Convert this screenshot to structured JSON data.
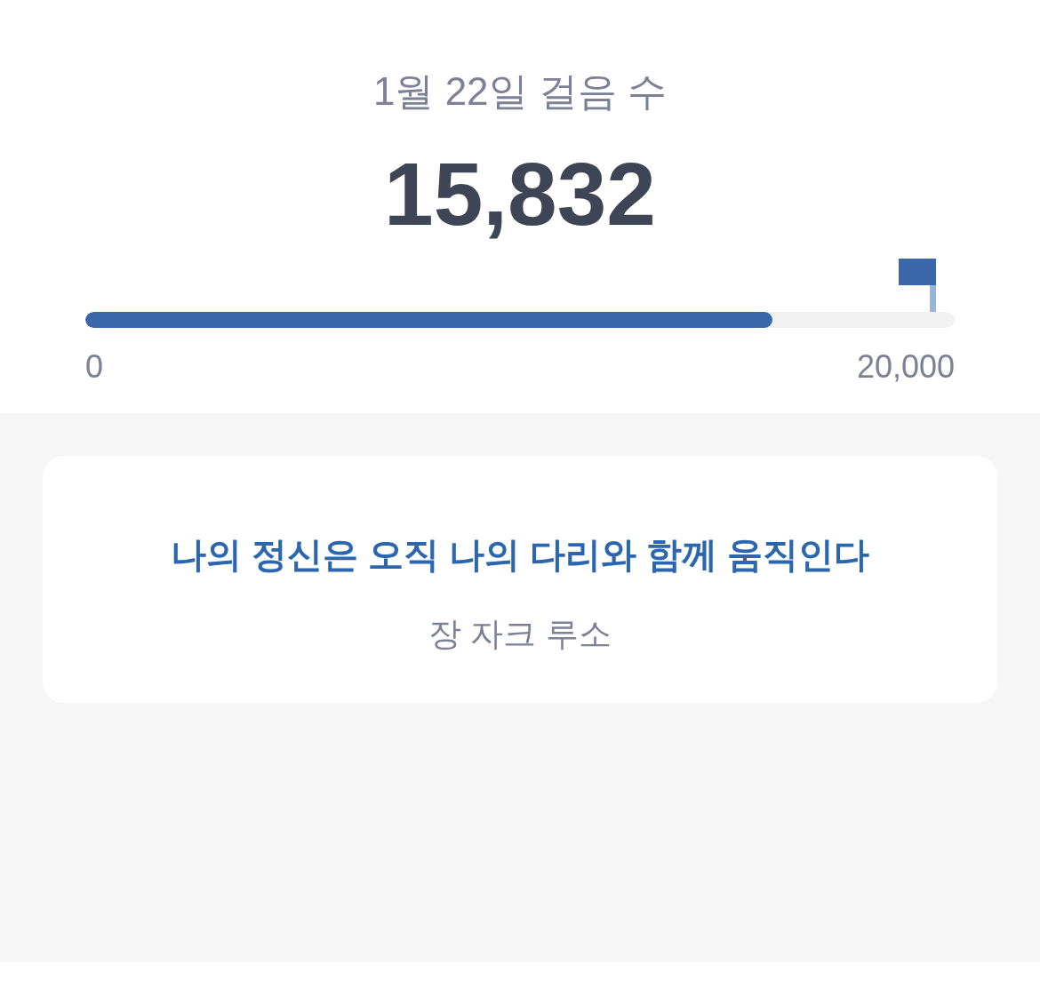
{
  "header": {
    "title": "1월 22일 걸음 수",
    "steps": "15,832"
  },
  "progress": {
    "level": 0.79,
    "min_label": "0",
    "max_label": "20,000"
  },
  "quote": {
    "text": "나의 정신은 오직 나의 다리와 함께 움직인다",
    "author": "장 자크 루소"
  }
}
